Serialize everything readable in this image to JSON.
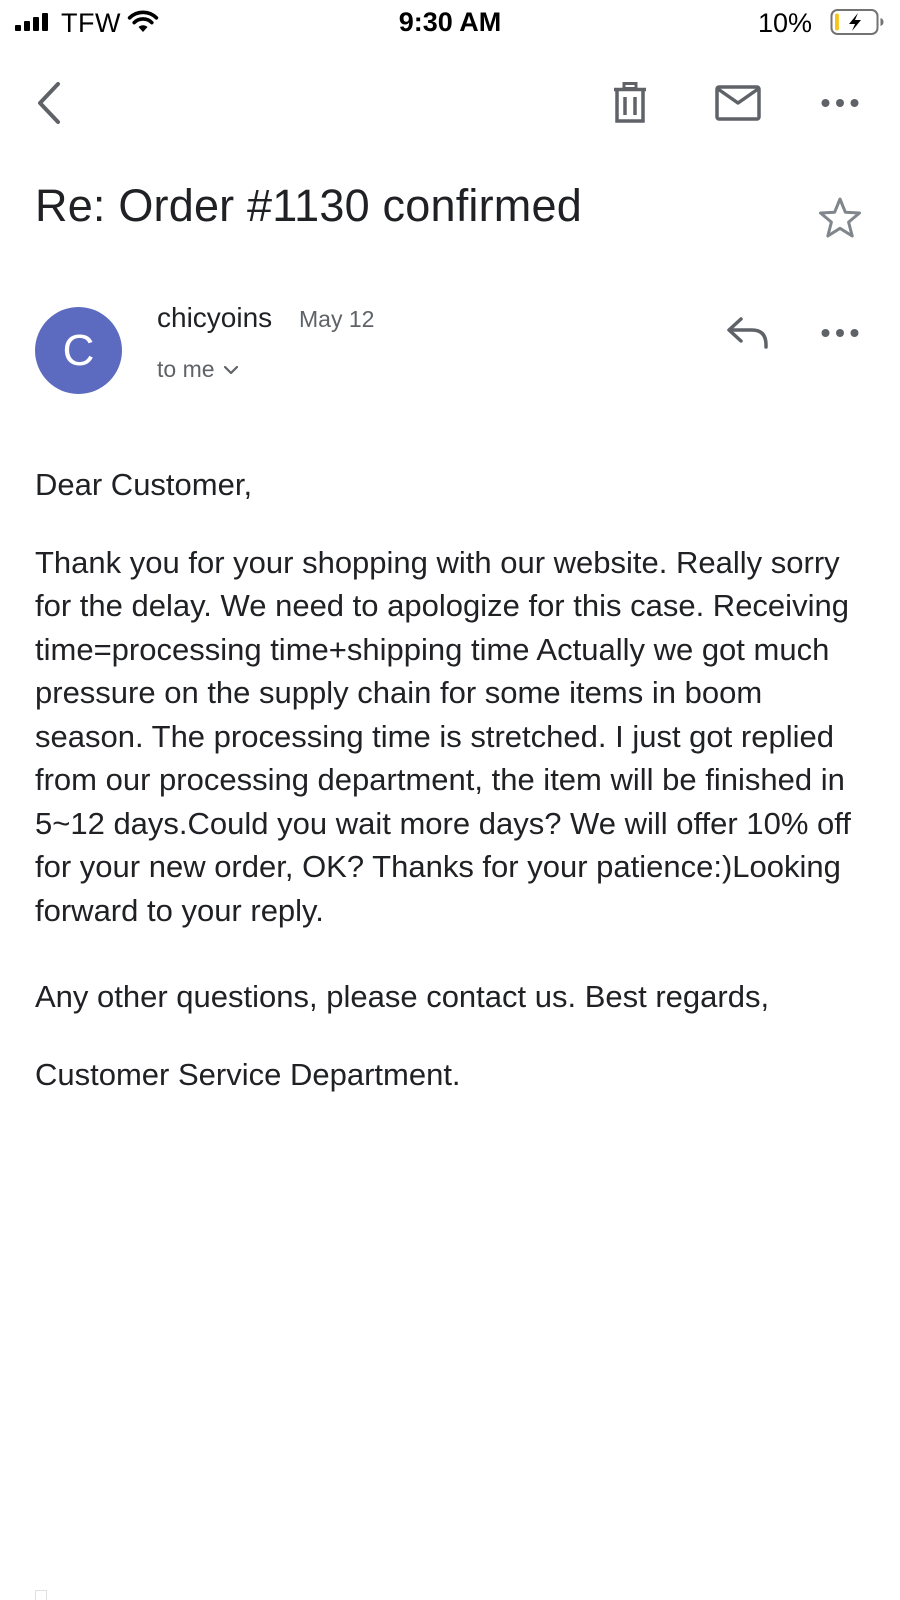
{
  "status_bar": {
    "carrier": "TFW",
    "time": "9:30 AM",
    "battery_percent": "10%",
    "battery_level": 0.1,
    "charging": true
  },
  "toolbar": {
    "icons": [
      "back-arrow-icon",
      "trash-icon",
      "mail-icon",
      "more-horizontal-icon"
    ]
  },
  "email": {
    "subject": "Re: Order #1130 confirmed",
    "sender": {
      "initial": "C",
      "name": "chicyoins",
      "date": "May 12",
      "recipient": "to me",
      "avatar_color": "#5c6bc0"
    },
    "body": {
      "greeting": "Dear Customer,",
      "main": "Thank you for your shopping with our website. Really sorry for the delay. We need to apologize for this case.  Receiving time=processing time+shipping time Actually we got much pressure on the supply chain for some items in boom season. The processing time is stretched.  I just got replied from our processing department, the item will be finished in 5~12 days.Could you wait more days? We will offer 10% off for your new order, OK? Thanks for your patience:)Looking forward to your reply.",
      "closing": "Any other questions, please contact us. Best regards,",
      "signature": "Customer Service Department."
    }
  }
}
